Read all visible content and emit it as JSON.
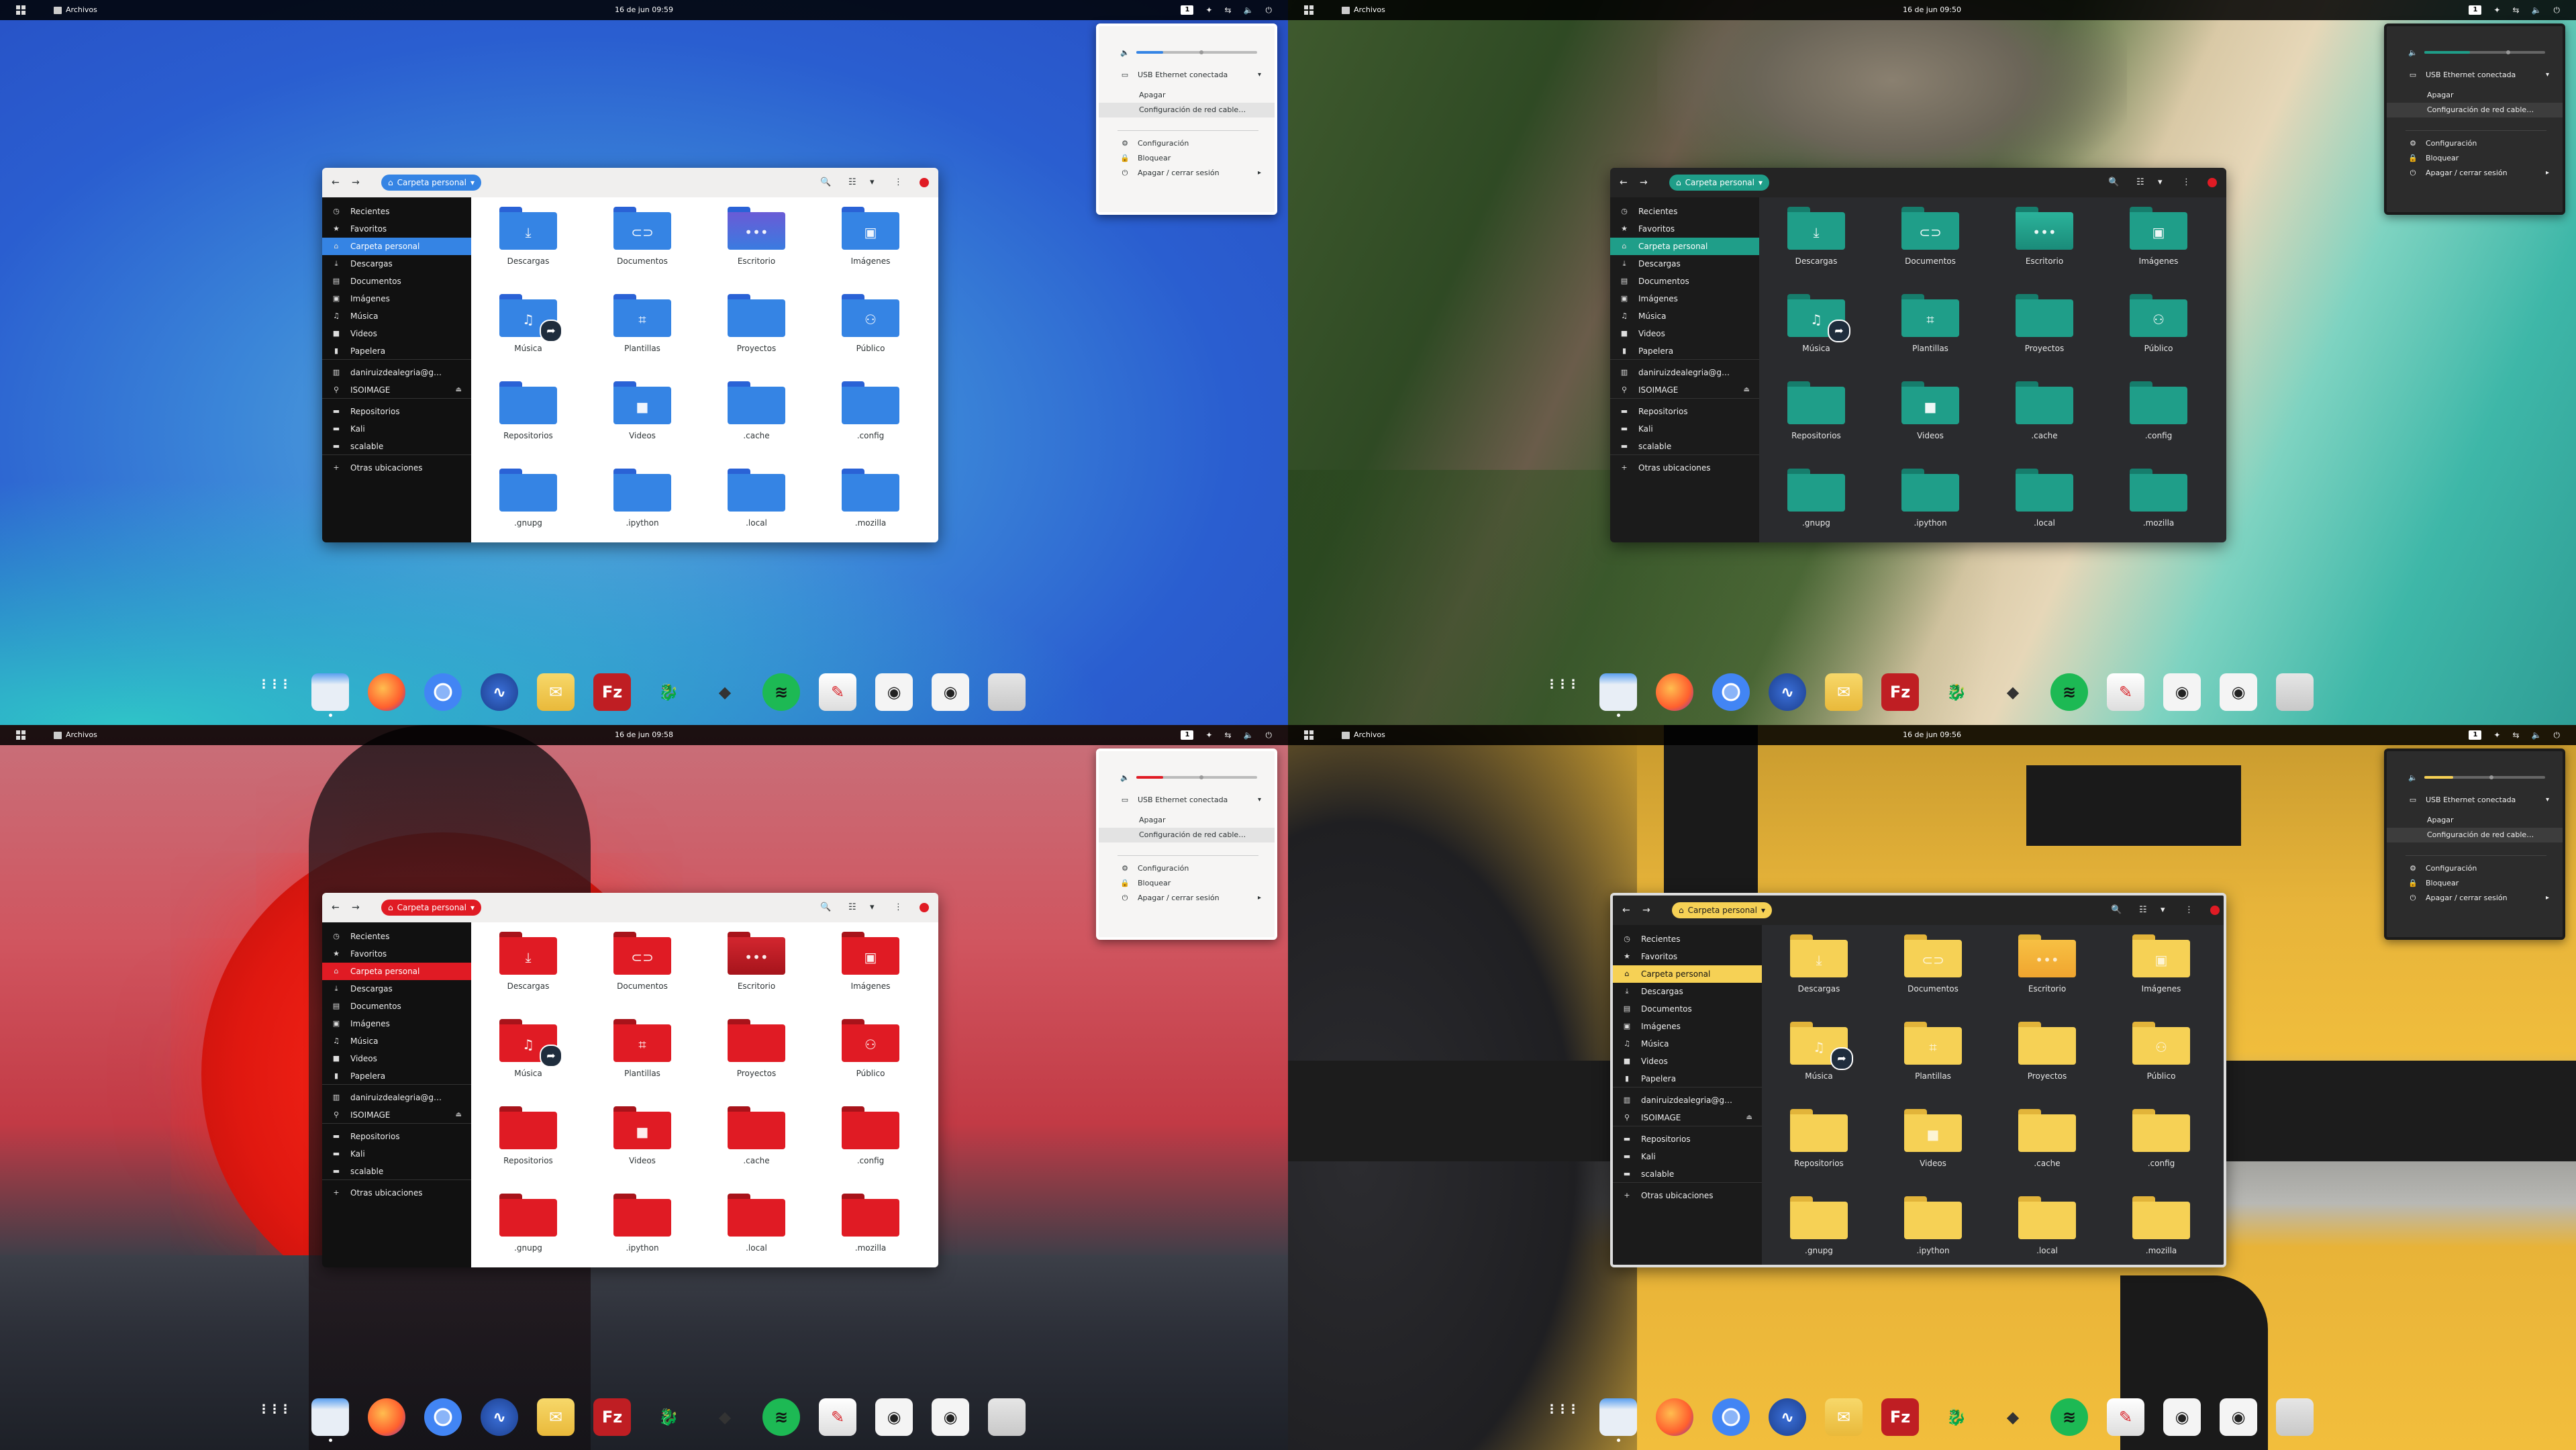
{
  "top_bar": {
    "app_name": "Archivos",
    "workspace": "1",
    "tray_icons": [
      "accessibility-icon",
      "network-icon",
      "volume-icon",
      "power-icon"
    ]
  },
  "quadrants": [
    {
      "theme": "blue",
      "clock": "16 de jun 09:59",
      "accent": "#3584e4",
      "volume_fraction": 0.22
    },
    {
      "theme": "green",
      "clock": "16 de jun 09:50",
      "accent": "#1f9e89",
      "volume_fraction": 0.38
    },
    {
      "theme": "red",
      "clock": "16 de jun 09:58",
      "accent": "#e01b24",
      "volume_fraction": 0.22
    },
    {
      "theme": "yellow",
      "clock": "16 de jun 09:56",
      "accent": "#f6d155",
      "volume_fraction": 0.24
    }
  ],
  "system_menu": {
    "network": "USB Ethernet conectada",
    "network_off": "Apagar",
    "network_settings": "Configuración de red cable…",
    "settings": "Configuración",
    "lock": "Bloquear",
    "power": "Apagar / cerrar sesión"
  },
  "files_window": {
    "location": "Carpeta personal",
    "sidebar": [
      {
        "label": "Recientes",
        "icon": "clock-icon"
      },
      {
        "label": "Favoritos",
        "icon": "star-icon"
      },
      {
        "label": "Carpeta personal",
        "icon": "home-icon",
        "active": true
      },
      {
        "label": "Descargas",
        "icon": "download-icon"
      },
      {
        "label": "Documentos",
        "icon": "document-icon"
      },
      {
        "label": "Imágenes",
        "icon": "image-icon"
      },
      {
        "label": "Música",
        "icon": "music-icon"
      },
      {
        "label": "Videos",
        "icon": "video-icon"
      },
      {
        "label": "Papelera",
        "icon": "trash-icon"
      },
      {
        "label": "daniruizdealegria@g…",
        "icon": "network-drive-icon"
      },
      {
        "label": "ISOIMAGE",
        "icon": "usb-icon",
        "eject": true
      },
      {
        "label": "Repositorios",
        "icon": "folder-icon"
      },
      {
        "label": "Kali",
        "icon": "folder-icon"
      },
      {
        "label": "scalable",
        "icon": "folder-icon"
      },
      {
        "label": "Otras ubicaciones",
        "icon": "plus-icon"
      }
    ],
    "items": [
      {
        "label": "Descargas",
        "icon": "download-folder-icon"
      },
      {
        "label": "Documentos",
        "icon": "documents-folder-icon"
      },
      {
        "label": "Escritorio",
        "icon": "desktop-folder-icon"
      },
      {
        "label": "Imágenes",
        "icon": "pictures-folder-icon"
      },
      {
        "label": "Música",
        "icon": "music-folder-icon"
      },
      {
        "label": "Plantillas",
        "icon": "templates-folder-icon"
      },
      {
        "label": "Proyectos",
        "icon": "folder-icon"
      },
      {
        "label": "Público",
        "icon": "public-folder-icon"
      },
      {
        "label": "Repositorios",
        "icon": "folder-icon"
      },
      {
        "label": "Videos",
        "icon": "videos-folder-icon"
      },
      {
        "label": ".cache",
        "icon": "folder-icon"
      },
      {
        "label": ".config",
        "icon": "folder-icon"
      },
      {
        "label": ".gnupg",
        "icon": "folder-icon"
      },
      {
        "label": ".ipython",
        "icon": "folder-icon"
      },
      {
        "label": ".local",
        "icon": "folder-icon"
      },
      {
        "label": ".mozilla",
        "icon": "folder-icon"
      }
    ]
  },
  "dock": [
    {
      "name": "show-apps-icon"
    },
    {
      "name": "files-icon"
    },
    {
      "name": "firefox-icon"
    },
    {
      "name": "chromium-icon"
    },
    {
      "name": "system-monitor-icon"
    },
    {
      "name": "mail-icon"
    },
    {
      "name": "filezilla-icon"
    },
    {
      "name": "kali-dragon-icon"
    },
    {
      "name": "inkscape-icon"
    },
    {
      "name": "spotify-icon"
    },
    {
      "name": "text-editor-icon"
    },
    {
      "name": "disk-icon"
    },
    {
      "name": "disk-icon"
    },
    {
      "name": "trash-icon"
    }
  ]
}
